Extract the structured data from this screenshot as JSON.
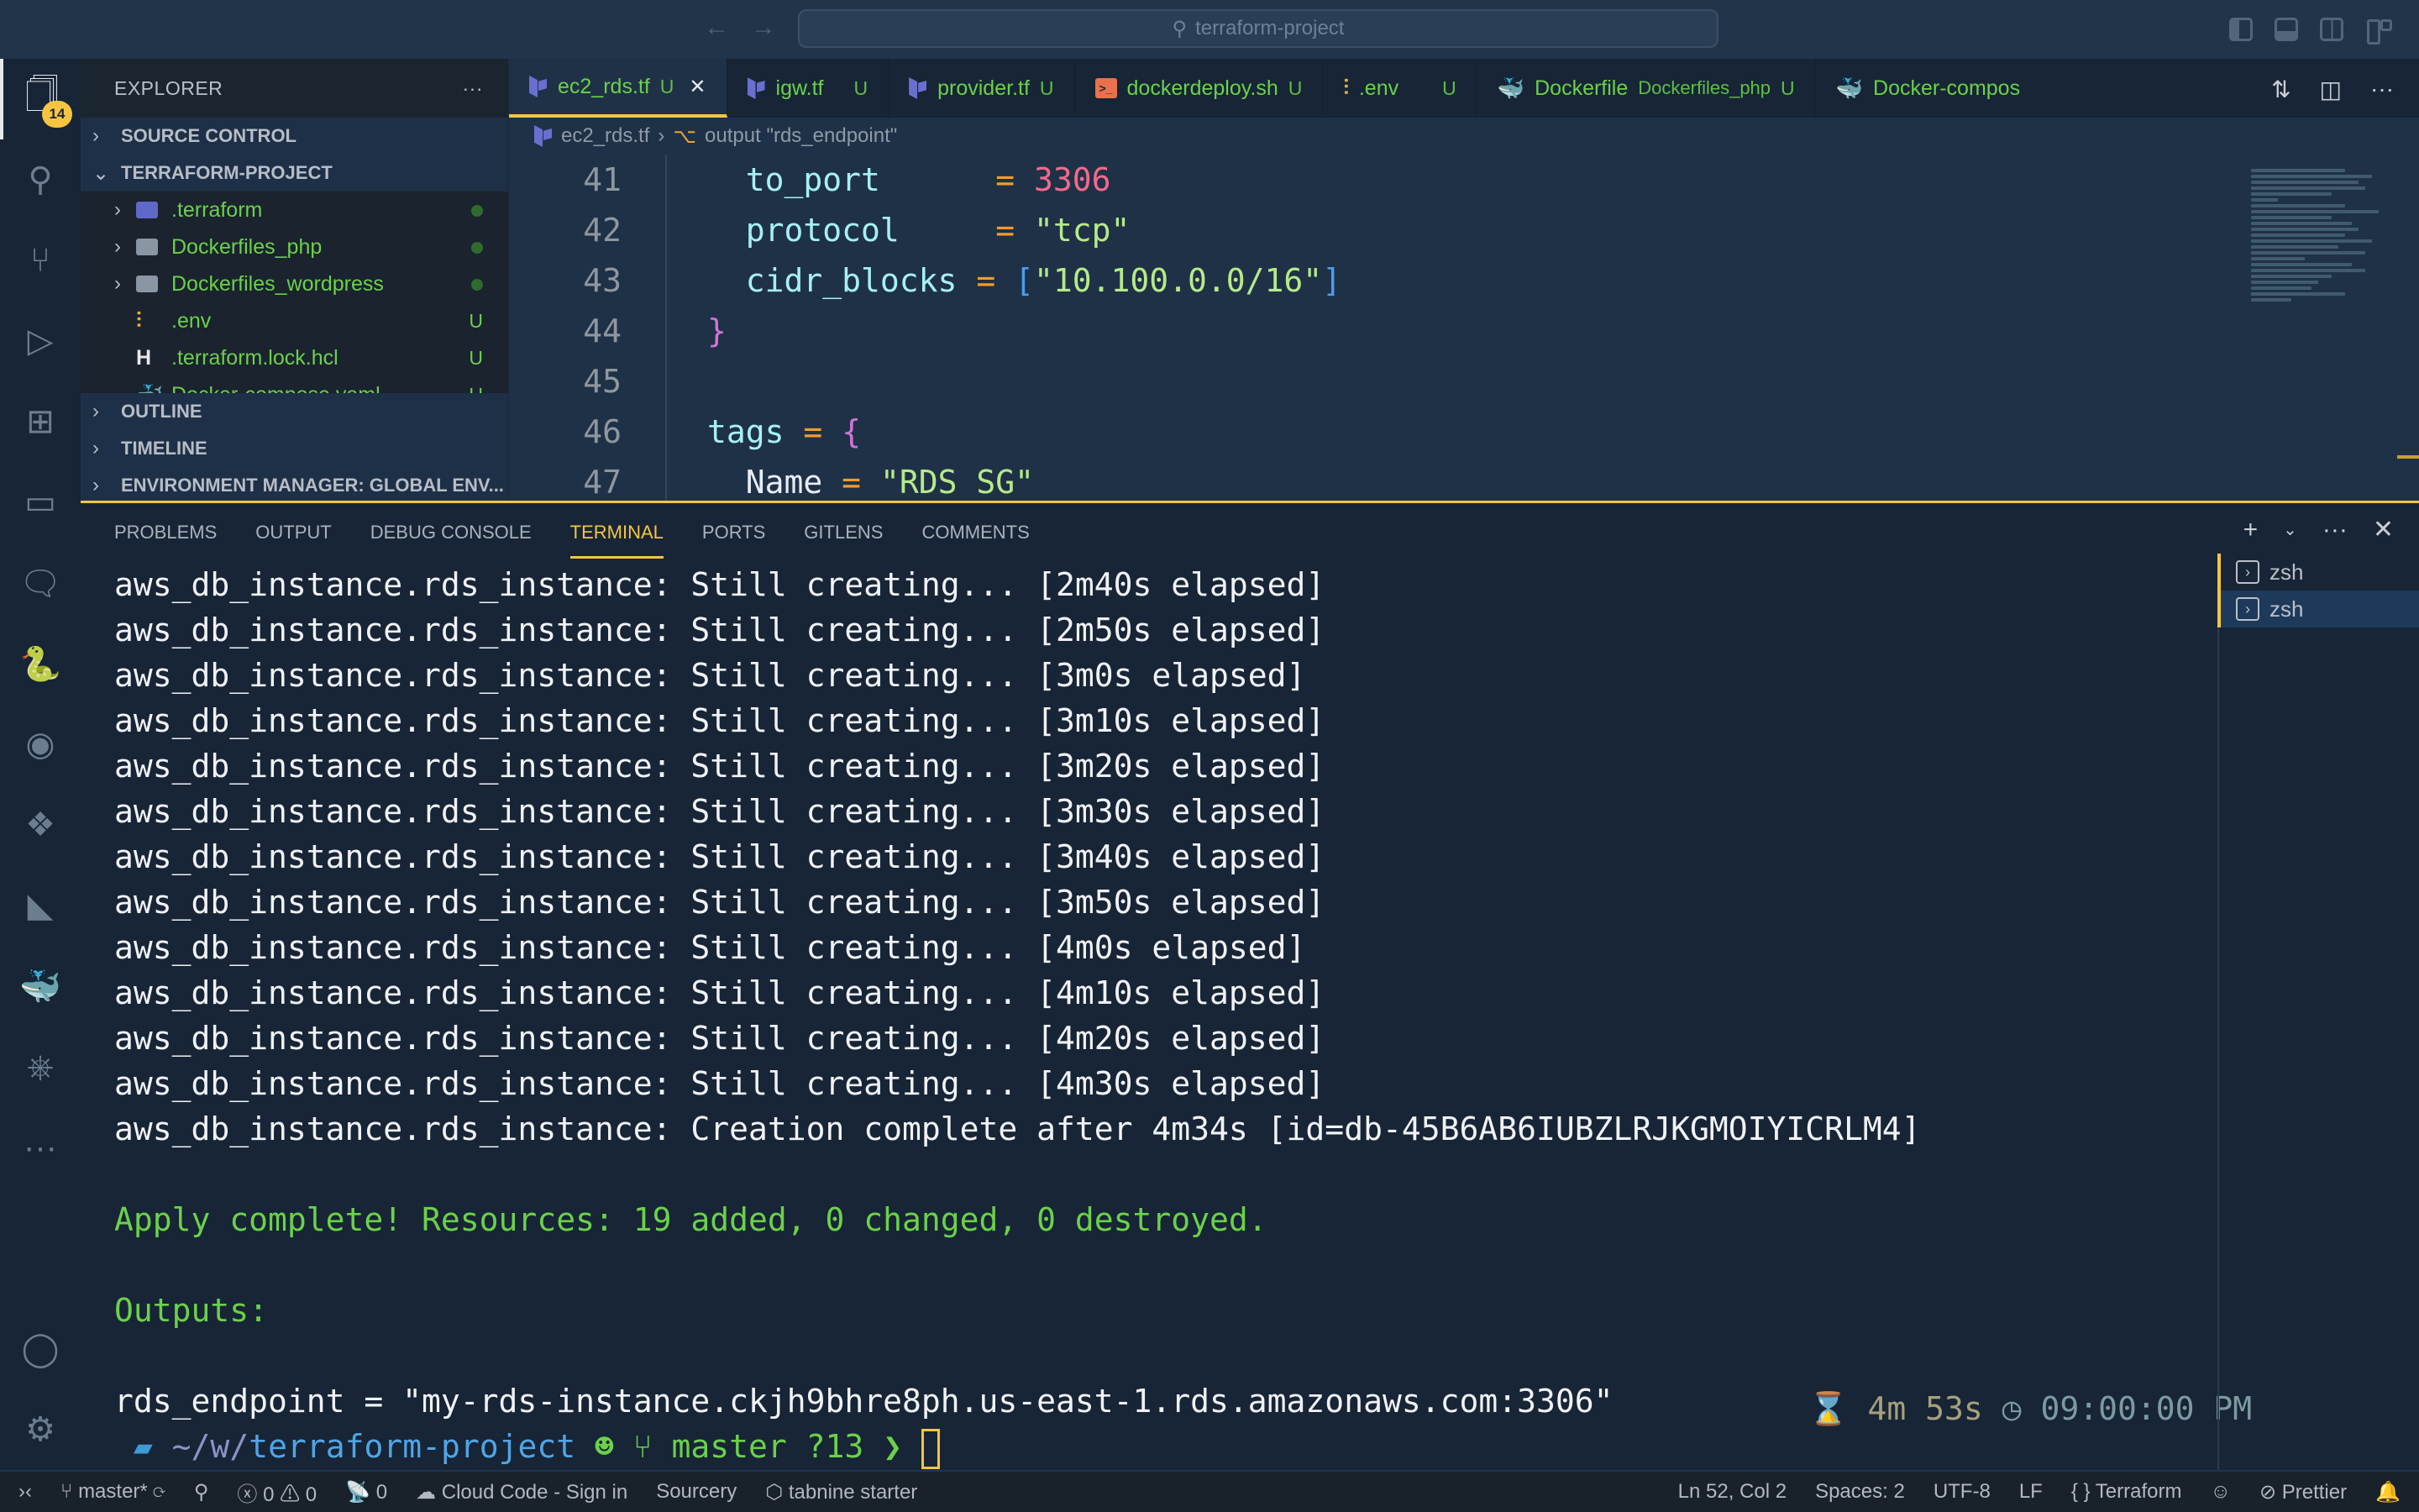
{
  "titlebar": {
    "search_text": "terraform-project",
    "back_icon": "arrow-left-icon",
    "forward_icon": "arrow-right-icon"
  },
  "activitybar": {
    "explorer_badge": "14",
    "items": [
      "explorer-icon",
      "search-icon",
      "source-control-icon",
      "run-debug-icon",
      "extensions-icon",
      "remote-explorer-icon",
      "comments-icon",
      "python-icon",
      "copilot-icon",
      "dropbox-icon",
      "terraform-icon",
      "docker-icon",
      "kubernetes-icon",
      "more-icon"
    ],
    "bottom": [
      "account-icon",
      "settings-gear-icon"
    ]
  },
  "sidebar": {
    "title": "EXPLORER",
    "more": "···",
    "sections_top": [
      {
        "label": "SOURCE CONTROL",
        "chevron": "›"
      },
      {
        "label": "TERRAFORM-PROJECT",
        "chevron": "⌄"
      }
    ],
    "tree": [
      {
        "name": ".terraform",
        "kind": "tf-folder",
        "deco": "dot"
      },
      {
        "name": "Dockerfiles_php",
        "kind": "folder",
        "deco": "dot"
      },
      {
        "name": "Dockerfiles_wordpress",
        "kind": "folder",
        "deco": "dot"
      },
      {
        "name": ".env",
        "kind": "env-file",
        "deco": "U"
      },
      {
        "name": ".terraform.lock.hcl",
        "kind": "hcl-file",
        "deco": "U"
      },
      {
        "name": "Docker-compose.yaml",
        "kind": "docker-file",
        "deco": "U"
      }
    ],
    "sections_bottom": [
      {
        "label": "OUTLINE"
      },
      {
        "label": "TIMELINE"
      },
      {
        "label": "ENVIRONMENT MANAGER: GLOBAL ENV..."
      }
    ]
  },
  "tabs": [
    {
      "label": "ec2_rds.tf",
      "status": "U",
      "icon": "terraform",
      "active": true
    },
    {
      "label": "igw.tf",
      "status": "U",
      "icon": "terraform"
    },
    {
      "label": "provider.tf",
      "status": "U",
      "icon": "terraform"
    },
    {
      "label": "dockerdeploy.sh",
      "status": "U",
      "icon": "shell"
    },
    {
      "label": ".env",
      "status": "U",
      "icon": "env"
    },
    {
      "label": "Dockerfile",
      "sub": "Dockerfiles_php",
      "status": "U",
      "icon": "docker"
    },
    {
      "label": "Docker-compos",
      "icon": "docker"
    }
  ],
  "breadcrumb": {
    "file": "ec2_rds.tf",
    "symbol": "output \"rds_endpoint\""
  },
  "editor": {
    "line_numbers": [
      "41",
      "42",
      "43",
      "44",
      "45",
      "46",
      "47"
    ],
    "lines": [
      {
        "key": "to_port",
        "pad": "     ",
        "eq": "=",
        "value": "3306",
        "type": "num"
      },
      {
        "key": "protocol",
        "pad": "    ",
        "eq": "=",
        "value": "\"tcp\"",
        "type": "str"
      },
      {
        "key": "cidr_blocks",
        "pad": " ",
        "eq": "=",
        "value": "\"10.100.0.0/16\"",
        "type": "list"
      },
      {
        "brace": "}"
      },
      {},
      {
        "key": "tags",
        "eq": "=",
        "brace": "{"
      },
      {
        "key": "Name",
        "eq": "=",
        "value": "\"RDS SG\"",
        "type": "str"
      }
    ]
  },
  "panel": {
    "tabs": [
      "PROBLEMS",
      "OUTPUT",
      "DEBUG CONSOLE",
      "TERMINAL",
      "PORTS",
      "GITLENS",
      "COMMENTS"
    ],
    "active_tab": "TERMINAL",
    "actions": {
      "new_terminal": "+",
      "dropdown": "⌄",
      "more": "···",
      "close": "✕"
    },
    "terminals": [
      {
        "label": "zsh",
        "selected": false
      },
      {
        "label": "zsh",
        "selected": true
      }
    ],
    "output": [
      "aws_db_instance.rds_instance: Still creating... [2m40s elapsed]",
      "aws_db_instance.rds_instance: Still creating... [2m50s elapsed]",
      "aws_db_instance.rds_instance: Still creating... [3m0s elapsed]",
      "aws_db_instance.rds_instance: Still creating... [3m10s elapsed]",
      "aws_db_instance.rds_instance: Still creating... [3m20s elapsed]",
      "aws_db_instance.rds_instance: Still creating... [3m30s elapsed]",
      "aws_db_instance.rds_instance: Still creating... [3m40s elapsed]",
      "aws_db_instance.rds_instance: Still creating... [3m50s elapsed]",
      "aws_db_instance.rds_instance: Still creating... [4m0s elapsed]",
      "aws_db_instance.rds_instance: Still creating... [4m10s elapsed]",
      "aws_db_instance.rds_instance: Still creating... [4m20s elapsed]",
      "aws_db_instance.rds_instance: Still creating... [4m30s elapsed]",
      "aws_db_instance.rds_instance: Creation complete after 4m34s [id=db-45B6AB6IUBZLRJKGMOIYICRLM4]"
    ],
    "apply_complete": "Apply complete! Resources: 19 added, 0 changed, 0 destroyed.",
    "outputs_label": "Outputs:",
    "endpoint_line": "rds_endpoint = \"my-rds-instance.ckjh9bhre8ph.us-east-1.rds.amazonaws.com:3306\"",
    "prompt": {
      "path_prefix": "~/w/",
      "path_dir": "terraform-project",
      "branch": "master",
      "untracked": "?13",
      "arrow": "❯"
    },
    "rprompt": {
      "duration": "4m 53s",
      "time": "09:00:00 PM"
    }
  },
  "statusbar": {
    "remote": "›‹",
    "branch": "master*",
    "errors": "0",
    "warnings": "0",
    "ports": "0",
    "cloud_code": "Cloud Code - Sign in",
    "sourcery": "Sourcery",
    "tabnine": "tabnine starter",
    "position": "Ln 52, Col 2",
    "spaces": "Spaces: 2",
    "encoding": "UTF-8",
    "eol": "LF",
    "language": "Terraform",
    "prettier": "Prettier"
  },
  "colors": {
    "accent": "#f5c542",
    "git_untracked": "#6cd14a",
    "editor_bg": "#1f3147",
    "panel_bg": "#172536"
  }
}
